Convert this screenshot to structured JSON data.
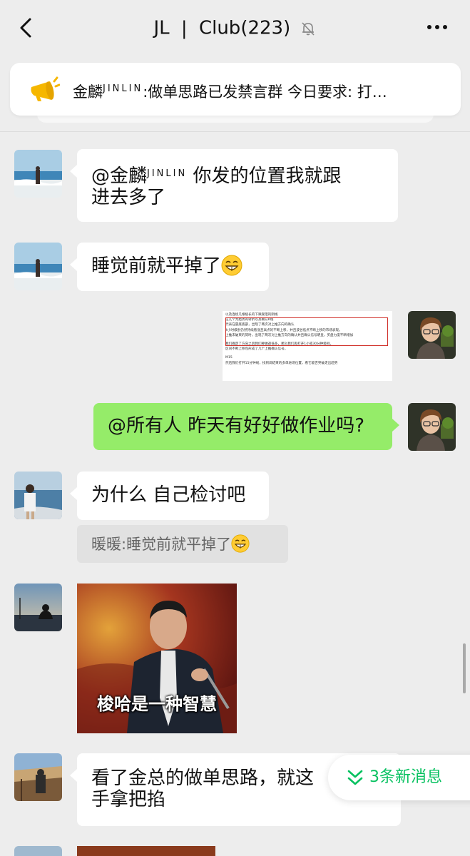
{
  "header": {
    "name": "JL",
    "separator": "|",
    "group": "Club",
    "member_count": "(223)"
  },
  "announcement": {
    "sender": "金麟",
    "sender_sup": "JINLIN",
    "text": ":做单思路已发禁言群  今日要求:  打…"
  },
  "messages": {
    "m1": {
      "mention": "@金麟",
      "mention_sup": "JINLIN",
      "line1_tail": " 你发的位置我就跟",
      "line2": "进去多了"
    },
    "m2": {
      "text": "睡觉前就平掉了"
    },
    "m3": {
      "doc_lines": [
        "以及连续几根极长的下跌受阻的阴线",
        "这几个为趋势的转折以及确认K线",
        "代表在震底底部，出现了两次对上推方向的确认",
        "4小时级别仍然持续看涨且高点的不断上移，并且波谷低点不断上移的市场表现。",
        "上推未破束的同时，出现了两次对上推方向的确认并且确认信号明显，买盘力度不断增加",
        "我们确定了方向之后我们要做逢低多，那么我们再打开1小或30分钟级别。",
        "区间不断上移包形成了几个上推确认信号。",
        "M15",
        "然后我们打开15分钟线，找到调结束的多单进场位置，看它能否突破走出趋势"
      ]
    },
    "m4": {
      "text": "@所有人 昨天有好好做作业吗?"
    },
    "m5": {
      "text": "为什么 自己检讨吧",
      "quote": "暖暖:睡觉前就平掉了"
    },
    "m6": {
      "caption": "梭哈是一种智慧"
    },
    "m7": {
      "line1": "看了金总的做单思路，就这",
      "line2": "手拿把掐"
    }
  },
  "new_messages": {
    "label": "3条新消息"
  },
  "colors": {
    "bg": "#ededed",
    "out_bubble": "#95ec69",
    "in_bubble": "#ffffff",
    "accent_green": "#07c160"
  },
  "icons": [
    "back-arrow-icon",
    "mute-bell-icon",
    "more-icon",
    "speaker-icon",
    "double-chevron-down-icon",
    "grin-emoji-icon"
  ]
}
